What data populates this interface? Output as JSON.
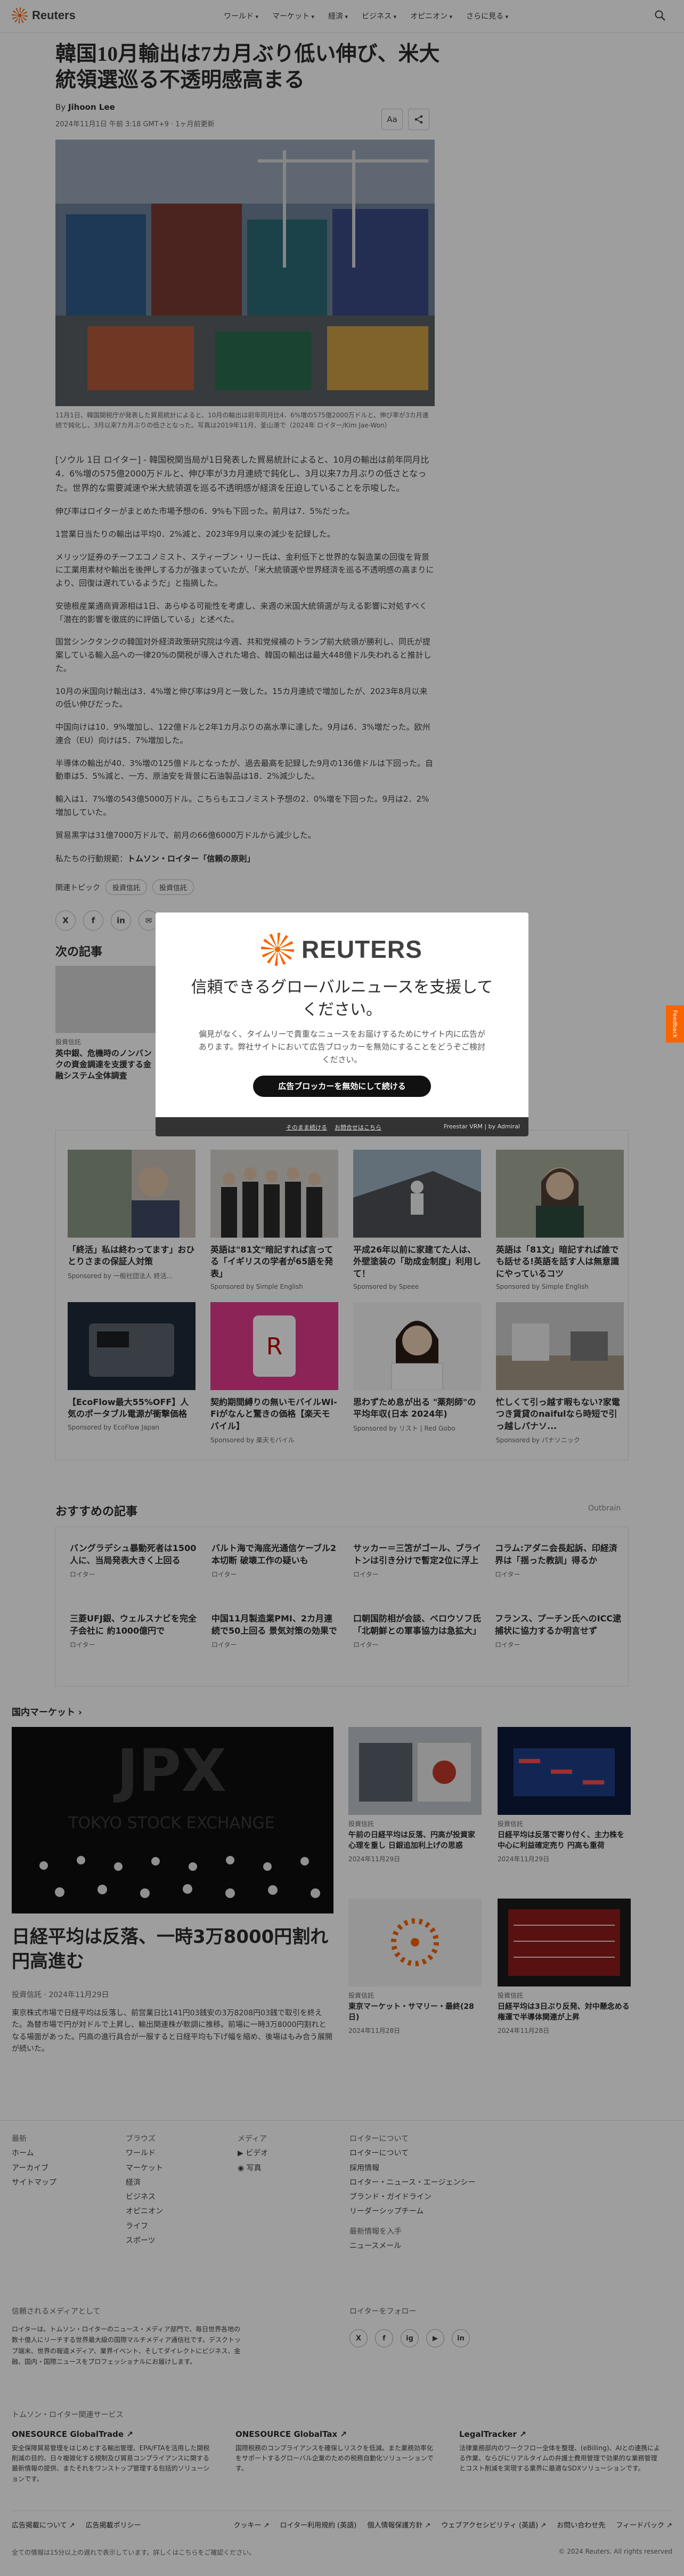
{
  "header": {
    "logo": "Reuters",
    "nav": [
      "ワールド",
      "マーケット",
      "経済",
      "ビジネス",
      "オピニオン",
      "さらに見る"
    ]
  },
  "article": {
    "headline": "韓国10月輸出は7カ月ぶり低い伸び、米大統領選巡る不透明感高まる",
    "by": "By",
    "author": "Jihoon Lee",
    "date": "2024年11月1日 午前 3:18 GMT+9 · 1ヶ月前更新",
    "font_button": "Aa",
    "caption": "11月1日、韓国関税庁が発表した貿易統計によると、10月の輸出は前年同月比4．6%増の575億2000万ドルと、伸び率が3カ月連続で鈍化し、3月以来7カ月ぶりの低さとなった。写真は2019年11月、釜山港で（2024年 ロイター/Kim Jae-Won）",
    "paragraphs": [
      "[ソウル 1日 ロイター] - 韓国税関当局が1日発表した貿易統計によると、10月の輸出は前年同月比4．6%増の575億2000万ドルと、伸び率が3カ月連続で鈍化し、3月以来7カ月ぶりの低さとなった。世界的な需要減速や米大統領選を巡る不透明感が経済を圧迫していることを示唆した。",
      "伸び率はロイターがまとめた市場予想の6．9%も下回った。前月は7．5%だった。",
      "1営業日当たりの輸出は平均0．2%減と、2023年9月以来の減少を記録した。",
      "メリッツ証券のチーフエコノミスト、スティーブン・リー氏は、金利低下と世界的な製造業の回復を背景に工業用素材や輸出を後押しする力が強まっていたが、「米大統領選や世界経済を巡る不透明感の高まりにより、回復は遅れているようだ」と指摘した。",
      "安徳根産業通商資源相は1日、あらゆる可能性を考慮し、来週の米国大統領選が与える影響に対処すべく「潜在的影響を徹底的に評価している」と述べた。",
      "国営シンクタンクの韓国対外経済政策研究院は今週、共和党候補のトランプ前大統領が勝利し、同氏が提案している輸入品への一律20%の関税が導入された場合、韓国の輸出は最大448億ドル失われると推計した。",
      "10月の米国向け輸出は3．4%増と伸び率は9月と一致した。15カ月連続で増加したが、2023年8月以来の低い伸びだった。",
      "中国向けは10．9%増加し、122億ドルと2年1カ月ぶりの高水準に達した。9月は6．3%増だった。欧州連合（EU）向けは5．7%増加した。",
      "半導体の輸出が40．3%増の125億ドルとなったが、過去最高を記録した9月の136億ドルは下回った。自動車は5．5%減と、一方、原油安を背景に石油製品は18．2%減少した。",
      "輸入は1．7%増の543億5000万ドル。こちらもエコノミスト予想の2．0%増を下回った。9月は2．2%増加していた。",
      "貿易黒字は31億7000万ドルで、前月の66億6000万ドルから減少した。"
    ],
    "related_prefix": "私たちの行動規範：",
    "related_link": "トムソン・ロイター「信頼の原則」",
    "topics_label": "関連トピック",
    "topics": [
      "投資信託",
      "投資信託"
    ],
    "share_icons": [
      "X",
      "f",
      "in",
      "✉"
    ]
  },
  "next": {
    "heading": "次の記事",
    "kicker": "投資信託",
    "title": "英中銀、危機時のノンバンクの資金調達を支援する金融システム全体調査"
  },
  "sponsored": [
    {
      "title": "「終活」私は終わってます」おひとりさまの保証人対策",
      "source": "Sponsored by 一般社団法人 終活..."
    },
    {
      "title": "英語は\"81文\"暗記すれば言ってる「イギリスの学者が65語を発表」",
      "source": "Sponsored by Simple English"
    },
    {
      "title": "平成26年以前に家建てた人は、外壁塗装の「助成金制度」利用して！",
      "source": "Sponsored by Speee"
    },
    {
      "title": "英語は「81文」暗記すれば誰でも話せる!英語を話す人は無意識にやっているコツ",
      "source": "Sponsored by Simple English"
    },
    {
      "title": "【EcoFlow最大55%OFF】人気のポータブル電源が衝撃価格",
      "source": "Sponsored by EcoFlow Japan"
    },
    {
      "title": "契約期間縛りの無いモバイルWi-Fiがなんと驚きの価格【楽天モバイル】",
      "source": "Sponsored by 楽天モバイル"
    },
    {
      "title": "思わずため息が出る \"薬剤師\"の平均年収(日本 2024年)",
      "source": "Sponsored by リスト | Red Gobo"
    },
    {
      "title": "忙しくて引っ越す暇もない?家電つき賃貸のnaifulなら時短で引っ越しパナソ...",
      "source": "Sponsored by パナソニック"
    }
  ],
  "recommended": {
    "heading": "おすすめの記事",
    "provider": "Outbrain",
    "items": [
      {
        "title": "バングラデシュ暴動死者は1500人に、当局発表大きく上回る",
        "source": "ロイター"
      },
      {
        "title": "バルト海で海底光通信ケーブル2本切断 破壊工作の疑いも",
        "source": "ロイター"
      },
      {
        "title": "サッカー＝三笘がゴール、ブライトンは引き分けで暫定2位に浮上",
        "source": "ロイター"
      },
      {
        "title": "コラム:アダニ会長起訴、印経済界は「揺った教訓」得るか",
        "source": "ロイター"
      },
      {
        "title": "三菱UFJ銀、ウェルスナビを完全子会社に 約1000億円で",
        "source": "ロイター"
      },
      {
        "title": "中国11月製造業PMI、2カ月連続で50上回る 景気対策の効果で",
        "source": "ロイター"
      },
      {
        "title": "口朝国防相が会談、ベロウソフ氏「北朝鮮との軍事協力は急拡大」",
        "source": "ロイター"
      },
      {
        "title": "フランス、プーチン氏へのICC逮捕状に協力するか明言せず",
        "source": "ロイター"
      }
    ]
  },
  "domestic": {
    "heading": "国内マーケット ›",
    "main_title": "日経平均は反落、一時3万8000円割れ 円高進む",
    "main_meta": "投資信託 · 2024年11月29日",
    "main_desc": "東京株式市場で日経平均は反落し、前営業日比141円03銭安の3万8208円03銭で取引を終えた。為替市場で円が対ドルで上昇し、輸出関連株が軟調に推移。前場に一時3万8000円割れとなる場面があった。円高の進行具合が一服すると日経平均も下げ幅を縮め、後場はもみ合う展開が続いた。",
    "img_text": "JPX",
    "img_sub": "TOKYO STOCK EXCHANGE",
    "cards": [
      {
        "kicker": "投資信託",
        "title": "午前の日経平均は反落、円高が投資家心理を重し 日銀追加利上げの思惑",
        "date": "2024年11月29日"
      },
      {
        "kicker": "投資信託",
        "title": "日経平均は反落で寄り付く、主力株を中心に利益確定売り 円高も重荷",
        "date": "2024年11月29日"
      },
      {
        "kicker": "投資信託",
        "title": "東京マーケット・サマリー・最終(28日)",
        "date": "2024年11月28日"
      },
      {
        "kicker": "投資信託",
        "title": "日経平均は3日ぶり反発、対中懸念める権運で半導体関連が上昇",
        "date": "2024年11月28日"
      }
    ]
  },
  "footer": {
    "col1": {
      "head": "最新",
      "items": [
        "ホーム",
        "アーカイブ",
        "サイトマップ"
      ]
    },
    "col2": {
      "head": "ブラウズ",
      "items": [
        "ワールド",
        "マーケット",
        "経済",
        "ビジネス",
        "オピニオン",
        "ライフ",
        "スポーツ"
      ]
    },
    "col3": {
      "head": "メディア",
      "items": [
        "ビデオ",
        "写真"
      ]
    },
    "col4": {
      "head": "ロイターについて",
      "items": [
        "ロイターについて",
        "採用情報",
        "ロイター・ニュース・エージェンシー",
        "ブランド・ガイドライン",
        "リーダーシップチーム"
      ]
    },
    "col4b": {
      "head": "最新情報を入手",
      "items": [
        "ニュースメール"
      ]
    },
    "trusted_head": "信頼されるメディアとして",
    "trusted_text": "ロイターは、トムソン・ロイターのニュース・メディア部門で、毎日世界各地の数十億人にリーチする世界最大級の国際マルチメディア通信社です。デスクトップ端末、世界の報道メディア、業界イベント、そしてダイレクトにビジネス、金融、国内・国際ニュースをプロフェッショナルにお届けします。",
    "follow_head": "ロイターをフォロー",
    "follow_icons": [
      "X",
      "f",
      "ig",
      "▶",
      "in"
    ],
    "tr_head": "トムソン・ロイター関連サービス",
    "products": [
      {
        "title": "ONESOURCE GlobalTrade ↗",
        "desc": "安全保障貿易管理をはじめとする輸出管理、EPA/FTAを活用した関税削減の目的、日々複雑化する規制及び貿易コンプライアンスに関する最新情報の提供、またそれをワンストップ管理する包括的ソリューションです。"
      },
      {
        "title": "ONESOURCE GlobalTax ↗",
        "desc": "国際税務のコンプライアンスを確保しリスクを低減。また業務効率化をサポートするグローバル企業のための税務自動化ソリューションです。"
      },
      {
        "title": "LegalTracker ↗",
        "desc": "法律業務部内のワークフロー全体を整理、(eBilling)、AIとの連携による作業、ならびにリアルタイムの弁護士費用管理で効果的な業務管理とコスト削減を実現する業界に最適なSDXソリューションです。"
      }
    ],
    "legal_left": [
      "広告掲載について ↗",
      "広告掲載ポリシー"
    ],
    "legal_right": [
      "クッキー ↗",
      "ロイター利用規約 (英語)",
      "個人情報保護方針 ↗",
      "ウェブアクセシビリティ (英語) ↗",
      "お問い合わせ先",
      "フィードバック ↗"
    ],
    "fine": "全ての情報は15分以上の遅れで表示しています。詳しくはこちらをご確認ください。",
    "copyright": "© 2024 Reuters. All rights reserved"
  },
  "modal": {
    "logo": "REUTERS",
    "title": "信頼できるグローバルニュースを支援してください。",
    "body": "偏見がなく、タイムリーで貴重なニュースをお届けするためにサイト内に広告があります。弊社サイトにおいて広告ブロッカーを無効にすることをどうぞご検討ください。",
    "button": "広告ブロッカーを無効にして続ける",
    "links": [
      "そのまま続ける",
      "お問合せはこちら"
    ],
    "brand": "Freestar VRM | by Admiral"
  },
  "feedback": "Feedback"
}
